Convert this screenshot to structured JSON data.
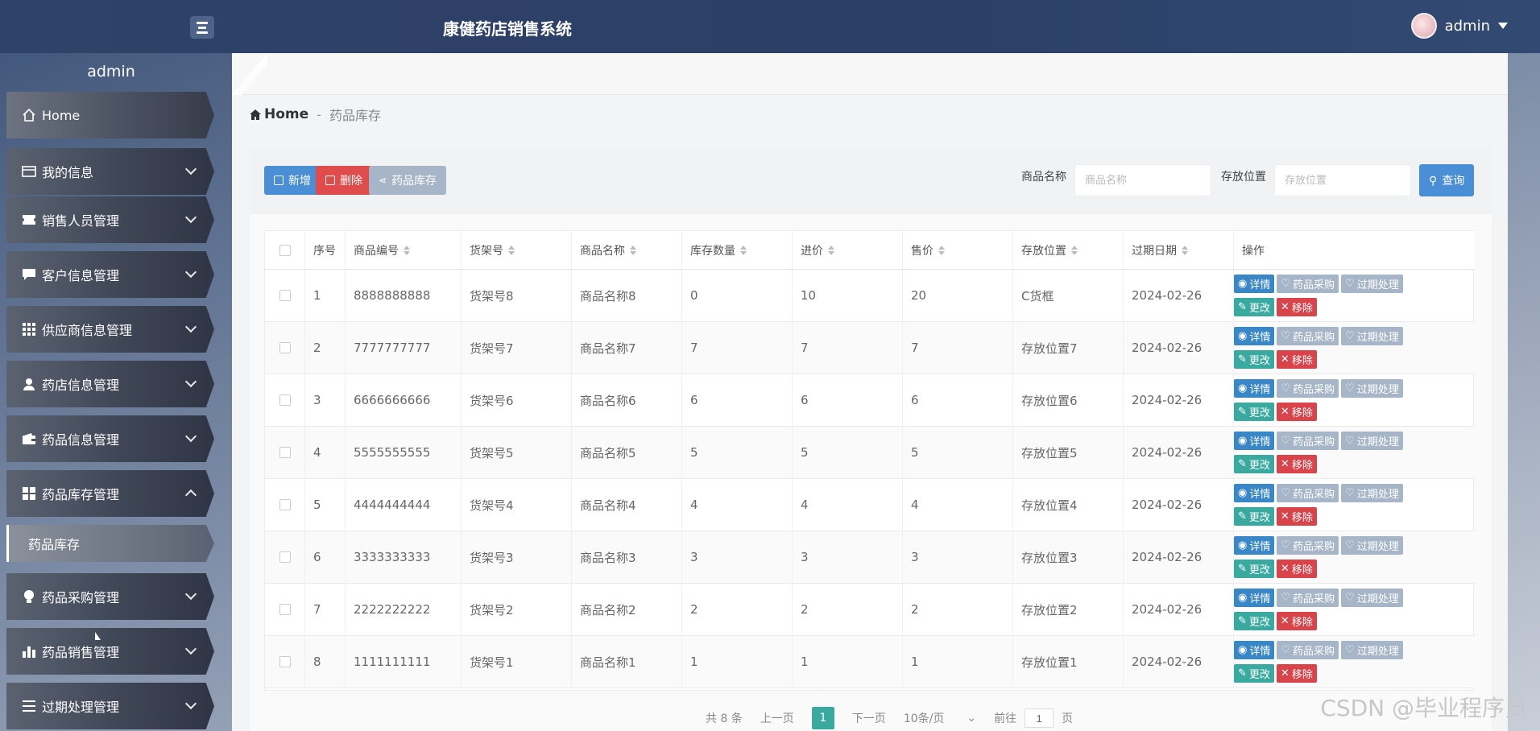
{
  "header": {
    "app_title": "康健药店销售系统",
    "user_name": "admin"
  },
  "sidebar": {
    "user": "admin",
    "items": [
      {
        "label": "Home",
        "icon": "home-icon"
      },
      {
        "label": "我的信息",
        "icon": "card-icon"
      },
      {
        "label": "销售人员管理",
        "icon": "ticket-icon"
      },
      {
        "label": "客户信息管理",
        "icon": "chat-icon"
      },
      {
        "label": "供应商信息管理",
        "icon": "grid-icon"
      },
      {
        "label": "药店信息管理",
        "icon": "person-icon"
      },
      {
        "label": "药品信息管理",
        "icon": "wallet-icon"
      },
      {
        "label": "药品库存管理",
        "icon": "tiles-icon"
      },
      {
        "label": "药品采购管理",
        "icon": "bulb-icon"
      },
      {
        "label": "药品销售管理",
        "icon": "bar-chart-icon"
      },
      {
        "label": "过期处理管理",
        "icon": "menu-icon"
      }
    ],
    "sub_item": "药品库存"
  },
  "breadcrumb": {
    "home": "Home",
    "separator": "-",
    "current": "药品库存"
  },
  "toolbar": {
    "add": "新增",
    "delete": "删除",
    "stock": "药品库存",
    "name_label": "商品名称",
    "name_placeholder": "商品名称",
    "location_label": "存放位置",
    "location_placeholder": "存放位置",
    "search": "查询"
  },
  "table": {
    "headers": [
      "序号",
      "商品编号",
      "货架号",
      "商品名称",
      "库存数量",
      "进价",
      "售价",
      "存放位置",
      "过期日期",
      "操作"
    ],
    "rows": [
      [
        "1",
        "8888888888",
        "货架号8",
        "商品名称8",
        "0",
        "10",
        "20",
        "C货框",
        "2024-02-26"
      ],
      [
        "2",
        "7777777777",
        "货架号7",
        "商品名称7",
        "7",
        "7",
        "7",
        "存放位置7",
        "2024-02-26"
      ],
      [
        "3",
        "6666666666",
        "货架号6",
        "商品名称6",
        "6",
        "6",
        "6",
        "存放位置6",
        "2024-02-26"
      ],
      [
        "4",
        "5555555555",
        "货架号5",
        "商品名称5",
        "5",
        "5",
        "5",
        "存放位置5",
        "2024-02-26"
      ],
      [
        "5",
        "4444444444",
        "货架号4",
        "商品名称4",
        "4",
        "4",
        "4",
        "存放位置4",
        "2024-02-26"
      ],
      [
        "6",
        "3333333333",
        "货架号3",
        "商品名称3",
        "3",
        "3",
        "3",
        "存放位置3",
        "2024-02-26"
      ],
      [
        "7",
        "2222222222",
        "货架号2",
        "商品名称2",
        "2",
        "2",
        "2",
        "存放位置2",
        "2024-02-26"
      ],
      [
        "8",
        "1111111111",
        "货架号1",
        "商品名称1",
        "1",
        "1",
        "1",
        "存放位置1",
        "2024-02-26"
      ]
    ],
    "actions": {
      "detail": "详情",
      "purchase": "药品采购",
      "expire": "过期处理",
      "edit": "更改",
      "remove": "移除"
    }
  },
  "pagination": {
    "total": "共 8 条",
    "prev": "上一页",
    "current": "1",
    "next": "下一页",
    "page_size": "10条/页",
    "goto": "前往",
    "goto_value": "1",
    "page_unit": "页"
  },
  "watermark": "CSDN @毕业程序员",
  "colors": {
    "primary": "#4a8fd6",
    "danger": "#e04b4b",
    "teal": "#3aaaa0",
    "muted": "#a6b6c8"
  }
}
